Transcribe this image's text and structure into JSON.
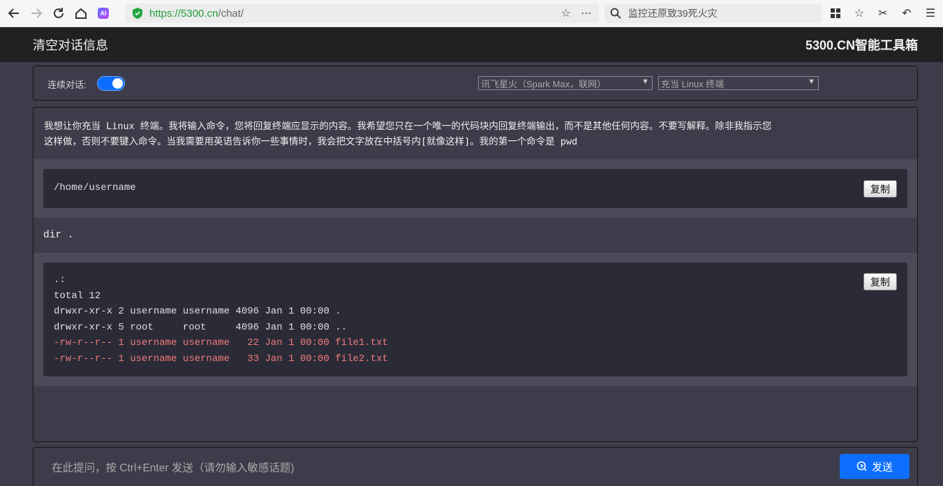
{
  "browser": {
    "url_scheme_host": "https://5300.cn",
    "url_path": "/chat/",
    "search_text": "监控还原致39死火灾",
    "ai_badge": "AI"
  },
  "header": {
    "clear_label": "清空对话信息",
    "brand": "5300.CN智能工具箱"
  },
  "controls": {
    "continuous_label": "连续对话:",
    "continuous_enabled": true,
    "model_select": "讯飞星火（Spark Max，联网）",
    "role_select": "充当 Linux 终端"
  },
  "chat": {
    "prompt_line1": "我想让你充当 Linux 终端。我将输入命令，您将回复终端应显示的内容。我希望您只在一个唯一的代码块内回复终端输出，而不是其他任何内容。不要写解释。除非我指示您",
    "prompt_line2": "这样做，否则不要键入命令。当我需要用英语告诉你一些事情时，我会把文字放在中括号内[就像这样]。我的第一个命令是 pwd",
    "reply1": "/home/username",
    "copy_label": "复制",
    "command2": "dir .",
    "reply2": [
      {
        "text": ".:",
        "highlight": false
      },
      {
        "text": "total 12",
        "highlight": false
      },
      {
        "text": "drwxr-xr-x 2 username username 4096 Jan 1 00:00 .",
        "highlight": false
      },
      {
        "text": "drwxr-xr-x 5 root     root     4096 Jan 1 00:00 ..",
        "highlight": false
      },
      {
        "text": "-rw-r--r-- 1 username username   22 Jan 1 00:00 file1.txt",
        "highlight": true
      },
      {
        "text": "-rw-r--r-- 1 username username   33 Jan 1 00:00 file2.txt",
        "highlight": true
      }
    ]
  },
  "input": {
    "placeholder": "在此提问，按 Ctrl+Enter 发送（请勿输入敏感话题)",
    "send_label": "发送"
  },
  "colors": {
    "accent": "#0d6efd",
    "header_bg": "#212121",
    "panel_bg": "#3c3c4a",
    "code_bg": "#2a2b36",
    "highlight_text": "#f07b7b"
  }
}
